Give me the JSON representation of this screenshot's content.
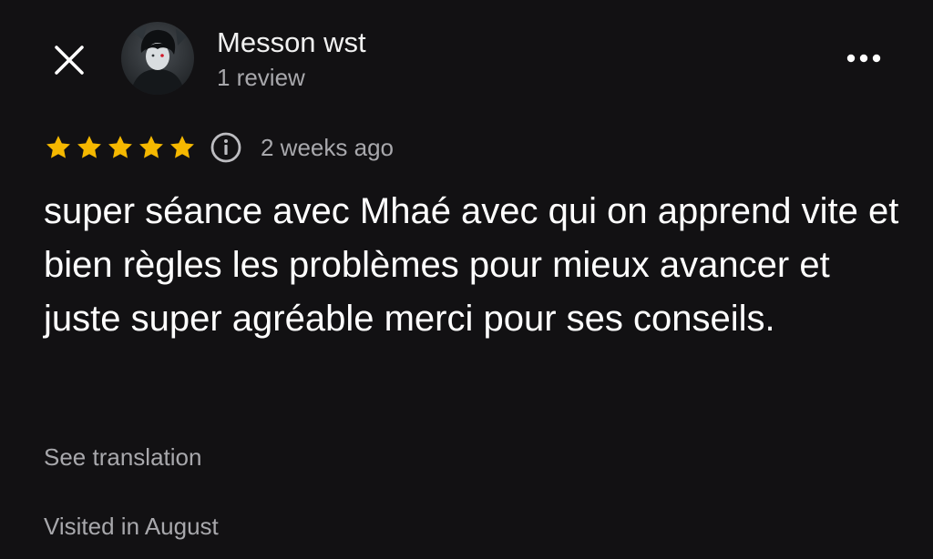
{
  "header": {
    "reviewer_name": "Messon wst",
    "review_count": "1 review",
    "close_icon": "close-icon",
    "more_icon": "more-horizontal-icon",
    "avatar_icon": "avatar"
  },
  "review": {
    "rating": 5,
    "rating_max": 5,
    "star_color": "#f5b800",
    "info_icon": "info-icon",
    "time_ago": "2 weeks ago",
    "text": "super séance avec Mhaé avec qui on apprend vite et bien règles les problèmes pour mieux avancer et juste super agréable merci pour ses conseils.",
    "see_translation": "See translation",
    "visited": "Visited in August"
  },
  "colors": {
    "background": "#121113",
    "primary_text": "#ffffff",
    "secondary_text": "#a8a8ac"
  }
}
